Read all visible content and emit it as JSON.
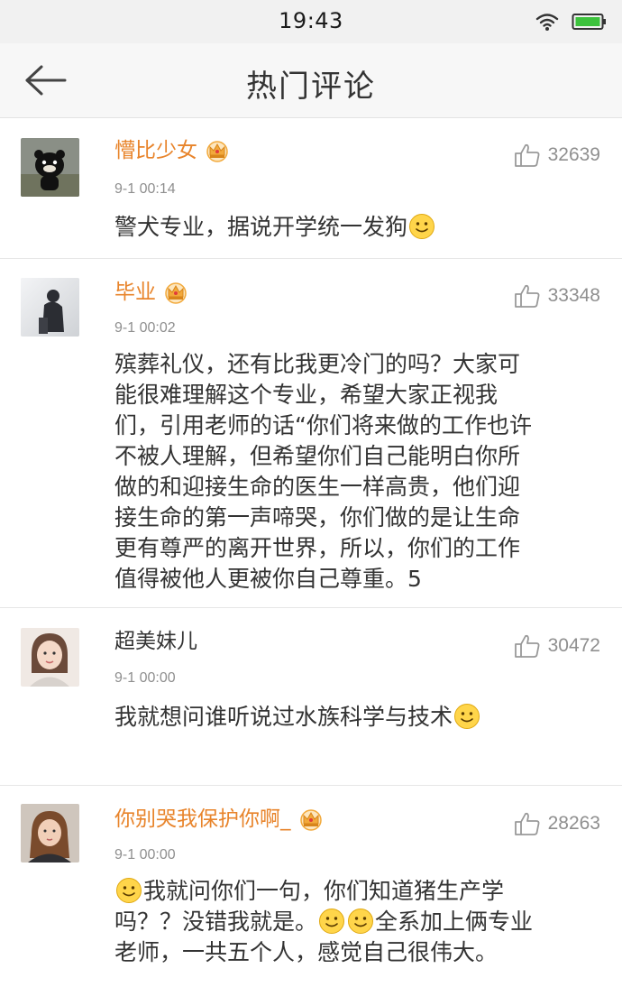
{
  "status_bar": {
    "time": "19:43"
  },
  "nav": {
    "title": "热门评论",
    "back_icon": "arrow-left-icon"
  },
  "colors": {
    "vip_name": "#e8842b",
    "normal_name": "#333333",
    "meta": "#8f8f8f",
    "crown": "#f2a93b",
    "battery": "#3cc23c"
  },
  "comments": [
    {
      "username": "懵比少女",
      "vip": true,
      "time": "9-1 00:14",
      "likes": "32639",
      "lines": [
        {
          "text": "警犬专业，据说开学统一发狗",
          "emoji_after": true
        }
      ]
    },
    {
      "username": "毕业",
      "vip": true,
      "time": "9-1 00:02",
      "likes": "33348",
      "lines": [
        {
          "text": "殡葬礼仪，还有比我更冷门的吗？大家可"
        },
        {
          "text": "能很难理解这个专业，希望大家正视我"
        },
        {
          "text": "们，引用老师的话“你们将来做的工作也许"
        },
        {
          "text": "不被人理解，但希望你们自己能明白你所"
        },
        {
          "text": "做的和迎接生命的医生一样高贵，他们迎"
        },
        {
          "text": "接生命的第一声啼哭，你们做的是让生命"
        },
        {
          "text": "更有尊严的离开世界，所以，你们的工作"
        },
        {
          "text": "值得被他人更被你自己尊重。5"
        }
      ]
    },
    {
      "username": "超美妹儿",
      "vip": false,
      "time": "9-1 00:00",
      "likes": "30472",
      "lines": [
        {
          "text": "我就想问谁听说过水族科学与技术",
          "emoji_after": true
        }
      ]
    },
    {
      "username": "你别哭我保护你啊_",
      "vip": true,
      "time": "9-1 00:00",
      "likes": "28263",
      "lines": [
        {
          "text": "我就问你们一句，你们知道猪生产学",
          "emoji_before": true
        },
        {
          "pre": "吗？？没错我就是。",
          "text": "全系加上俩专业",
          "emoji_middle": 2
        },
        {
          "text": "老师，一共五个人，感觉自己很伟大。"
        }
      ]
    }
  ]
}
